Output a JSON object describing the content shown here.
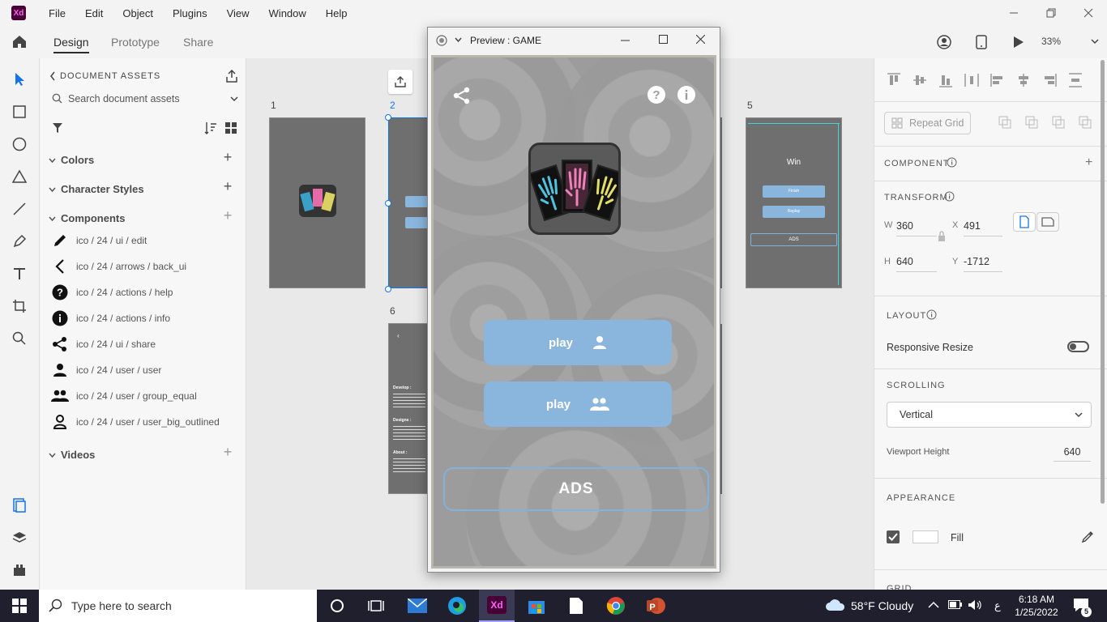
{
  "app": {
    "logo": "Xd",
    "menu": [
      "File",
      "Edit",
      "Object",
      "Plugins",
      "View",
      "Window",
      "Help"
    ]
  },
  "toolbar": {
    "tabs": [
      "Design",
      "Prototype",
      "Share"
    ],
    "zoom": "33%"
  },
  "assets": {
    "title": "DOCUMENT ASSETS",
    "search_placeholder": "Search document assets",
    "sections": {
      "colors": "Colors",
      "char_styles": "Character Styles",
      "components": "Components",
      "videos": "Videos"
    },
    "components": [
      {
        "label": "ico / 24 / ui / edit",
        "icon": "edit-icon"
      },
      {
        "label": "ico / 24 / arrows / back_ui",
        "icon": "back-icon"
      },
      {
        "label": "ico / 24 / actions / help",
        "icon": "help-icon"
      },
      {
        "label": "ico / 24 / actions / info",
        "icon": "info-icon"
      },
      {
        "label": "ico / 24 / ui / share",
        "icon": "share-icon"
      },
      {
        "label": "ico / 24 / user / user",
        "icon": "user-icon"
      },
      {
        "label": "ico / 24 / user / group_equal",
        "icon": "group-icon"
      },
      {
        "label": "ico / 24 / user / user_big_outlined",
        "icon": "user-outlined-icon"
      }
    ]
  },
  "canvas": {
    "artboards": [
      "1",
      "2",
      "5",
      "6"
    ],
    "ab5": {
      "title": "Win",
      "btn1": "Finish",
      "btn2": "Replay",
      "btn3": "ADS"
    },
    "ab6": {
      "develop": "Develop :",
      "designs": "Designs :",
      "about": "About :"
    }
  },
  "preview": {
    "title": "Preview : GAME",
    "play1": "play",
    "play2": "play",
    "ads": "ADS"
  },
  "props": {
    "repeat_grid": "Repeat Grid",
    "component": "COMPONENT",
    "transform": "TRANSFORM",
    "w_label": "W",
    "w": "360",
    "x_label": "X",
    "x": "491",
    "h_label": "H",
    "h": "640",
    "y_label": "Y",
    "y": "-1712",
    "layout": "LAYOUT",
    "responsive": "Responsive Resize",
    "scrolling": "SCROLLING",
    "scroll_value": "Vertical",
    "viewport_label": "Viewport Height",
    "viewport_value": "640",
    "appearance": "APPEARANCE",
    "fill": "Fill",
    "grid": "GRID"
  },
  "taskbar": {
    "search_placeholder": "Type here to search",
    "weather": "58°F  Cloudy",
    "time": "6:18 AM",
    "date": "1/25/2022",
    "lang": "ع",
    "notif_count": "5"
  },
  "colors": {
    "accent": "#1473e6",
    "play_button": "#8ab6dd",
    "ads_border": "#7fb2de",
    "xd_logo": "#470137"
  }
}
